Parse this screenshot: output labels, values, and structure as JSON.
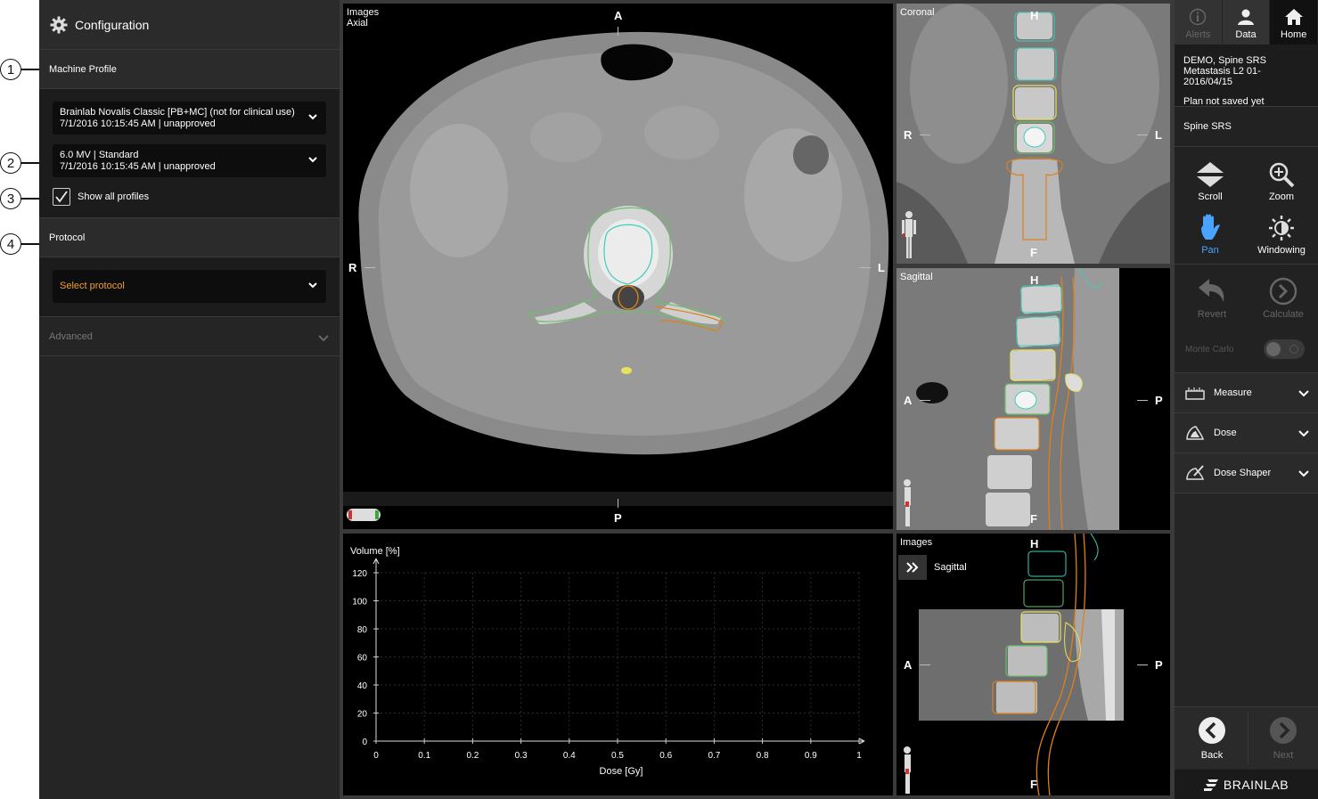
{
  "config": {
    "title": "Configuration",
    "machine_profile_label": "Machine Profile",
    "machine_profile_line1": "Brainlab Novalis Classic [PB+MC] (not for clinical use)",
    "machine_profile_line2": "7/1/2016 10:15:45 AM | unapproved",
    "energy_line1": "6.0 MV | Standard",
    "energy_line2": "7/1/2016 10:15:45 AM | unapproved",
    "show_all_label": "Show all profiles",
    "protocol_label": "Protocol",
    "protocol_placeholder": "Select protocol",
    "advanced_label": "Advanced"
  },
  "callouts": [
    "1",
    "2",
    "3",
    "4"
  ],
  "viewports": {
    "axial": {
      "label1": "Images",
      "label2": "Axial",
      "top": "A",
      "bottom": "P",
      "left": "R",
      "right": "L"
    },
    "coronal": {
      "label": "Coronal",
      "top": "H",
      "bottom": "F",
      "left": "R",
      "right": "L"
    },
    "sagittal": {
      "label": "Sagittal",
      "top": "H",
      "bottom": "F",
      "left": "A",
      "right": "P"
    },
    "images": {
      "label": "Images",
      "sublabel": "Sagittal",
      "top": "H",
      "bottom": "F",
      "left": "A",
      "right": "P"
    }
  },
  "chart_data": {
    "type": "line",
    "title": "",
    "xlabel": "Dose [Gy]",
    "ylabel": "Volume [%]",
    "xlim": [
      0,
      1
    ],
    "ylim": [
      0,
      120
    ],
    "xticks": [
      "0",
      "0.1",
      "0.2",
      "0.3",
      "0.4",
      "0.5",
      "0.6",
      "0.7",
      "0.8",
      "0.9",
      "1"
    ],
    "yticks": [
      "0",
      "20",
      "40",
      "60",
      "80",
      "100",
      "120"
    ],
    "series": [],
    "grid": true
  },
  "right": {
    "tabs": [
      {
        "label": "Alerts",
        "icon": "info-icon"
      },
      {
        "label": "Data",
        "icon": "patient-icon"
      },
      {
        "label": "Home",
        "icon": "home-icon"
      }
    ],
    "patient_line1": "DEMO, Spine SRS",
    "patient_line2": "Metastasis L2 01-2016/04/15",
    "plan_status": "Plan not saved yet",
    "plan_name": "Spine SRS",
    "tools": [
      {
        "label": "Scroll",
        "icon": "scroll-icon"
      },
      {
        "label": "Zoom",
        "icon": "zoom-icon"
      },
      {
        "label": "Pan",
        "icon": "pan-hand-icon"
      },
      {
        "label": "Windowing",
        "icon": "windowing-icon"
      }
    ],
    "revert_label": "Revert",
    "calculate_label": "Calculate",
    "monte_carlo_label": "Monte Carlo",
    "accordions": [
      {
        "label": "Measure",
        "icon": "ruler-icon"
      },
      {
        "label": "Dose",
        "icon": "dose-icon"
      },
      {
        "label": "Dose Shaper",
        "icon": "dose-shaper-icon"
      }
    ],
    "back_label": "Back",
    "next_label": "Next",
    "brand": "BRAINLAB"
  }
}
